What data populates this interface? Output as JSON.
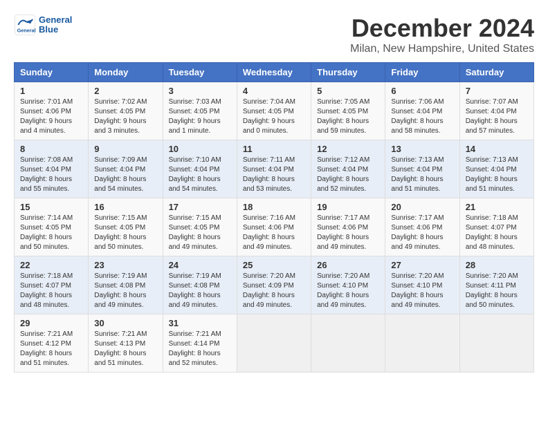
{
  "logo": {
    "line1": "General",
    "line2": "Blue"
  },
  "title": "December 2024",
  "location": "Milan, New Hampshire, United States",
  "weekdays": [
    "Sunday",
    "Monday",
    "Tuesday",
    "Wednesday",
    "Thursday",
    "Friday",
    "Saturday"
  ],
  "weeks": [
    [
      {
        "day": "1",
        "sunrise": "7:01 AM",
        "sunset": "4:06 PM",
        "daylight": "9 hours and 4 minutes."
      },
      {
        "day": "2",
        "sunrise": "7:02 AM",
        "sunset": "4:05 PM",
        "daylight": "9 hours and 3 minutes."
      },
      {
        "day": "3",
        "sunrise": "7:03 AM",
        "sunset": "4:05 PM",
        "daylight": "9 hours and 1 minute."
      },
      {
        "day": "4",
        "sunrise": "7:04 AM",
        "sunset": "4:05 PM",
        "daylight": "9 hours and 0 minutes."
      },
      {
        "day": "5",
        "sunrise": "7:05 AM",
        "sunset": "4:05 PM",
        "daylight": "8 hours and 59 minutes."
      },
      {
        "day": "6",
        "sunrise": "7:06 AM",
        "sunset": "4:04 PM",
        "daylight": "8 hours and 58 minutes."
      },
      {
        "day": "7",
        "sunrise": "7:07 AM",
        "sunset": "4:04 PM",
        "daylight": "8 hours and 57 minutes."
      }
    ],
    [
      {
        "day": "8",
        "sunrise": "7:08 AM",
        "sunset": "4:04 PM",
        "daylight": "8 hours and 55 minutes."
      },
      {
        "day": "9",
        "sunrise": "7:09 AM",
        "sunset": "4:04 PM",
        "daylight": "8 hours and 54 minutes."
      },
      {
        "day": "10",
        "sunrise": "7:10 AM",
        "sunset": "4:04 PM",
        "daylight": "8 hours and 54 minutes."
      },
      {
        "day": "11",
        "sunrise": "7:11 AM",
        "sunset": "4:04 PM",
        "daylight": "8 hours and 53 minutes."
      },
      {
        "day": "12",
        "sunrise": "7:12 AM",
        "sunset": "4:04 PM",
        "daylight": "8 hours and 52 minutes."
      },
      {
        "day": "13",
        "sunrise": "7:13 AM",
        "sunset": "4:04 PM",
        "daylight": "8 hours and 51 minutes."
      },
      {
        "day": "14",
        "sunrise": "7:13 AM",
        "sunset": "4:04 PM",
        "daylight": "8 hours and 51 minutes."
      }
    ],
    [
      {
        "day": "15",
        "sunrise": "7:14 AM",
        "sunset": "4:05 PM",
        "daylight": "8 hours and 50 minutes."
      },
      {
        "day": "16",
        "sunrise": "7:15 AM",
        "sunset": "4:05 PM",
        "daylight": "8 hours and 50 minutes."
      },
      {
        "day": "17",
        "sunrise": "7:15 AM",
        "sunset": "4:05 PM",
        "daylight": "8 hours and 49 minutes."
      },
      {
        "day": "18",
        "sunrise": "7:16 AM",
        "sunset": "4:06 PM",
        "daylight": "8 hours and 49 minutes."
      },
      {
        "day": "19",
        "sunrise": "7:17 AM",
        "sunset": "4:06 PM",
        "daylight": "8 hours and 49 minutes."
      },
      {
        "day": "20",
        "sunrise": "7:17 AM",
        "sunset": "4:06 PM",
        "daylight": "8 hours and 49 minutes."
      },
      {
        "day": "21",
        "sunrise": "7:18 AM",
        "sunset": "4:07 PM",
        "daylight": "8 hours and 48 minutes."
      }
    ],
    [
      {
        "day": "22",
        "sunrise": "7:18 AM",
        "sunset": "4:07 PM",
        "daylight": "8 hours and 48 minutes."
      },
      {
        "day": "23",
        "sunrise": "7:19 AM",
        "sunset": "4:08 PM",
        "daylight": "8 hours and 49 minutes."
      },
      {
        "day": "24",
        "sunrise": "7:19 AM",
        "sunset": "4:08 PM",
        "daylight": "8 hours and 49 minutes."
      },
      {
        "day": "25",
        "sunrise": "7:20 AM",
        "sunset": "4:09 PM",
        "daylight": "8 hours and 49 minutes."
      },
      {
        "day": "26",
        "sunrise": "7:20 AM",
        "sunset": "4:10 PM",
        "daylight": "8 hours and 49 minutes."
      },
      {
        "day": "27",
        "sunrise": "7:20 AM",
        "sunset": "4:10 PM",
        "daylight": "8 hours and 49 minutes."
      },
      {
        "day": "28",
        "sunrise": "7:20 AM",
        "sunset": "4:11 PM",
        "daylight": "8 hours and 50 minutes."
      }
    ],
    [
      {
        "day": "29",
        "sunrise": "7:21 AM",
        "sunset": "4:12 PM",
        "daylight": "8 hours and 51 minutes."
      },
      {
        "day": "30",
        "sunrise": "7:21 AM",
        "sunset": "4:13 PM",
        "daylight": "8 hours and 51 minutes."
      },
      {
        "day": "31",
        "sunrise": "7:21 AM",
        "sunset": "4:14 PM",
        "daylight": "8 hours and 52 minutes."
      },
      null,
      null,
      null,
      null
    ]
  ]
}
